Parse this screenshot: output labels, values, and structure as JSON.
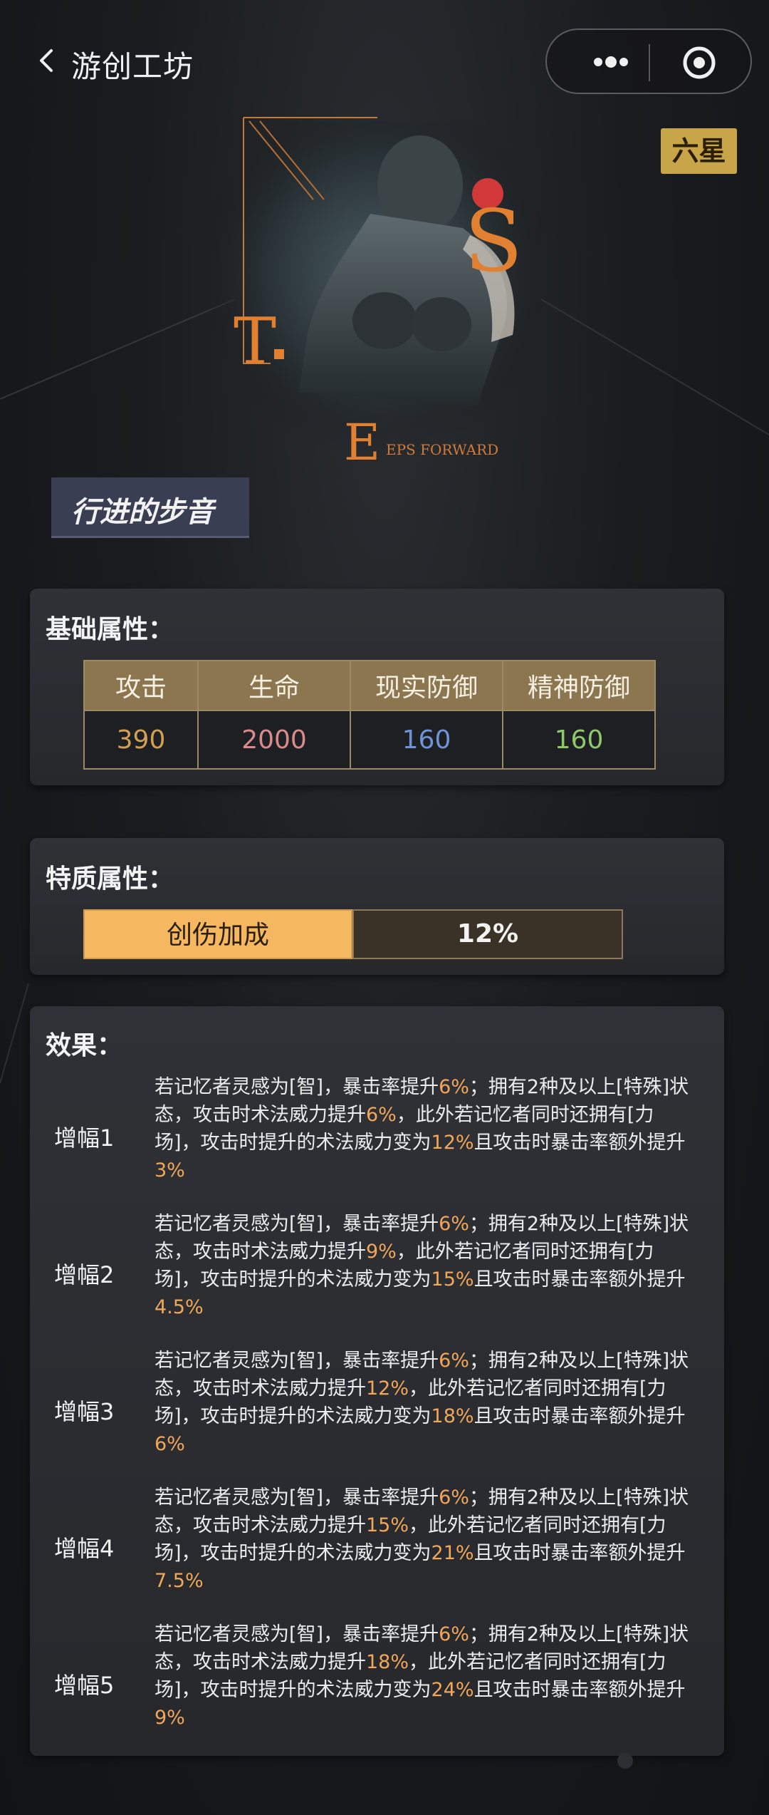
{
  "header": {
    "title": "游创工坊"
  },
  "card": {
    "rarity": "六星",
    "name": "行进的步音",
    "art_text": "EPS FORWARD"
  },
  "base_attributes": {
    "title": "基础属性：",
    "columns": [
      "攻击",
      "生命",
      "现实防御",
      "精神防御"
    ],
    "values": [
      "390",
      "2000",
      "160",
      "160"
    ],
    "value_colors": [
      "#d2a053",
      "#d98a8a",
      "#6e93d6",
      "#8fc86a"
    ]
  },
  "trait_attributes": {
    "title": "特质属性：",
    "name": "创伤加成",
    "value": "12%"
  },
  "effects": {
    "title": "效果：",
    "items": [
      {
        "label": "增幅1",
        "p1": "若记忆者灵感为[智]，暴击率提升",
        "v1": "6%",
        "p2": "；拥有2种及以上[特殊]状态，攻击时术法威力提升",
        "v2": "6%",
        "p3": "，此外若记忆者同时还拥有[力场]，攻击时提升的术法威力变为",
        "v3": "12%",
        "p4": "且攻击时暴击率额外提升",
        "v4": "3%"
      },
      {
        "label": "增幅2",
        "p1": "若记忆者灵感为[智]，暴击率提升",
        "v1": "6%",
        "p2": "；拥有2种及以上[特殊]状态，攻击时术法威力提升",
        "v2": "9%",
        "p3": "，此外若记忆者同时还拥有[力场]，攻击时提升的术法威力变为",
        "v3": "15%",
        "p4": "且攻击时暴击率额外提升",
        "v4": "4.5%"
      },
      {
        "label": "增幅3",
        "p1": "若记忆者灵感为[智]，暴击率提升",
        "v1": "6%",
        "p2": "；拥有2种及以上[特殊]状态，攻击时术法威力提升",
        "v2": "12%",
        "p3": "，此外若记忆者同时还拥有[力场]，攻击时提升的术法威力变为",
        "v3": "18%",
        "p4": "且攻击时暴击率额外提升",
        "v4": "6%"
      },
      {
        "label": "增幅4",
        "p1": "若记忆者灵感为[智]，暴击率提升",
        "v1": "6%",
        "p2": "；拥有2种及以上[特殊]状态，攻击时术法威力提升",
        "v2": "15%",
        "p3": "，此外若记忆者同时还拥有[力场]，攻击时提升的术法威力变为",
        "v3": "21%",
        "p4": "且攻击时暴击率额外提升",
        "v4": "7.5%"
      },
      {
        "label": "增幅5",
        "p1": "若记忆者灵感为[智]，暴击率提升",
        "v1": "6%",
        "p2": "；拥有2种及以上[特殊]状态，攻击时术法威力提升",
        "v2": "18%",
        "p3": "，此外若记忆者同时还拥有[力场]，攻击时提升的术法威力变为",
        "v3": "24%",
        "p4": "且攻击时暴击率额外提升",
        "v4": "9%"
      }
    ]
  }
}
